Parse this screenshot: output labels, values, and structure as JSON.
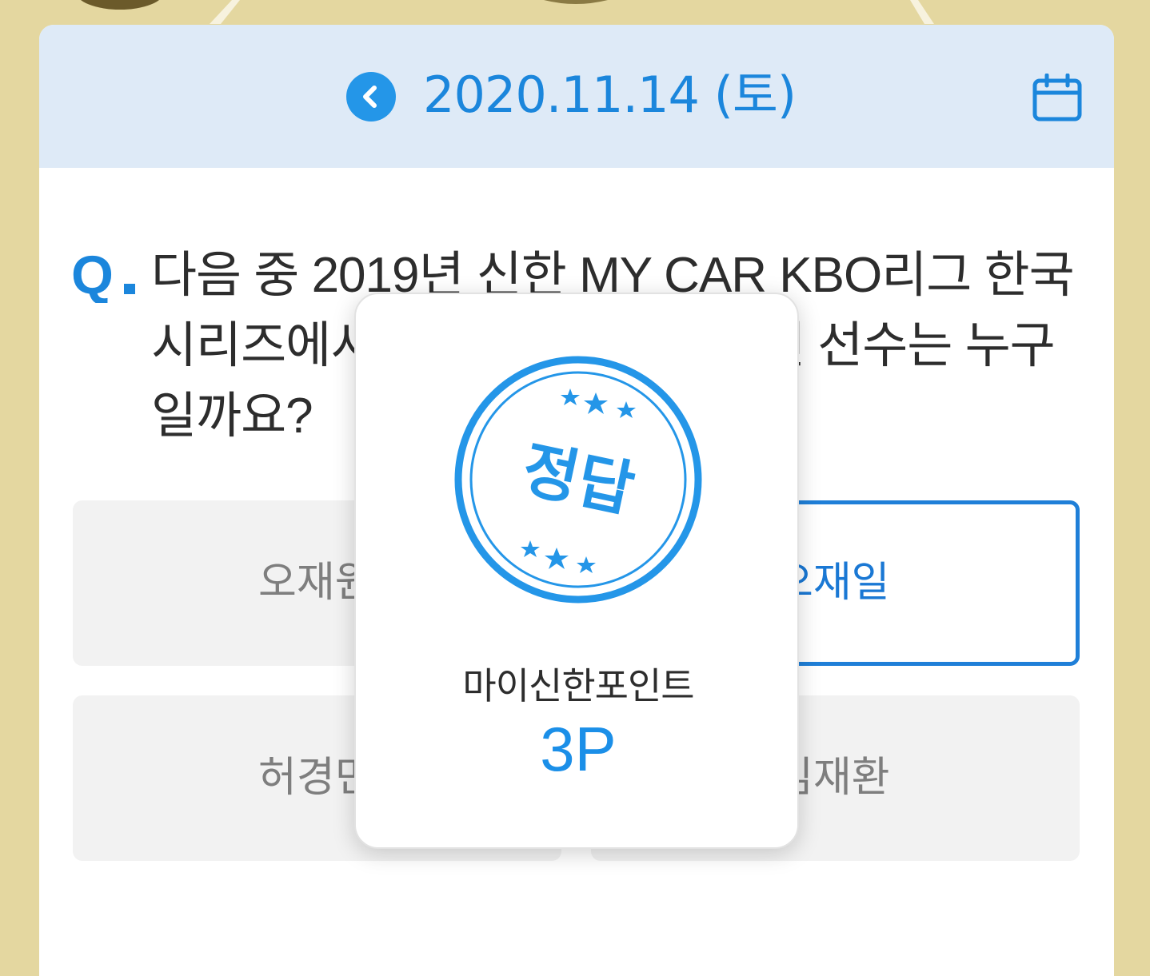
{
  "header": {
    "date": "2020.11.14  (토)",
    "prev_icon": "chevron-left-icon",
    "calendar_icon": "calendar-icon"
  },
  "question": {
    "prefix": "Q.",
    "text": "다음 중 2019년 신한 MY CAR KBO리그 한국시리즈에서 최우수선수로 뽑혔던 선수는 누구일까요?"
  },
  "options": [
    {
      "label": "오재원",
      "selected": false
    },
    {
      "label": "오재일",
      "selected": true
    },
    {
      "label": "허경민",
      "selected": false
    },
    {
      "label": "김재환",
      "selected": false
    }
  ],
  "result_popup": {
    "stamp_text": "정답",
    "points_label": "마이신한포인트",
    "points_value": "3P"
  },
  "colors": {
    "accent": "#1b86dc",
    "header_bg": "#deeaf7",
    "page_bg": "#e4d7a0",
    "option_bg": "#f2f2f2"
  }
}
